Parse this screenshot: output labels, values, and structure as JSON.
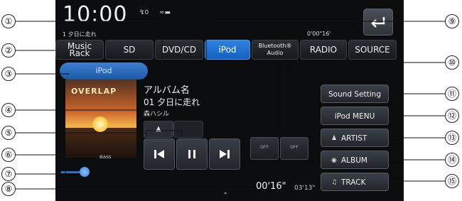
{
  "status": {
    "time": "10:00",
    "signal": "↯0",
    "battery": "≈▬"
  },
  "mini_track": {
    "text": "1 夕日に走れ",
    "time": "0'00\"16'"
  },
  "tabs": [
    {
      "label": "Music Rack",
      "active": false
    },
    {
      "label": "SD",
      "active": false
    },
    {
      "label": "DVD/CD",
      "active": false
    },
    {
      "label": "iPod",
      "active": true
    },
    {
      "label": "Bluetooth® Audio",
      "active": false
    },
    {
      "label": "RADIO",
      "active": false
    },
    {
      "label": "SOURCE",
      "active": false
    }
  ],
  "source_label": "iPod",
  "artwork_logo": "OVERLAP",
  "album": "アルバム名",
  "track": "01  夕日に走れ",
  "artist": "森ハシル",
  "bass_label": "Bass",
  "mode_buttons": [
    "OFF",
    "OFF"
  ],
  "side_buttons": [
    "Sound Setting",
    "iPod MENU",
    "ARTIST",
    "ALBUM",
    "TRACK"
  ],
  "elapsed": "00'16\"",
  "total": "03'13\"",
  "callouts": [
    "①",
    "②",
    "③",
    "④",
    "⑤",
    "⑥",
    "⑦",
    "⑧",
    "⑨",
    "⑩",
    "⑪",
    "⑫",
    "⑬",
    "⑭",
    "⑮"
  ],
  "colors": {
    "accent": "#1f6fd4",
    "background": "#0b0c0e"
  }
}
